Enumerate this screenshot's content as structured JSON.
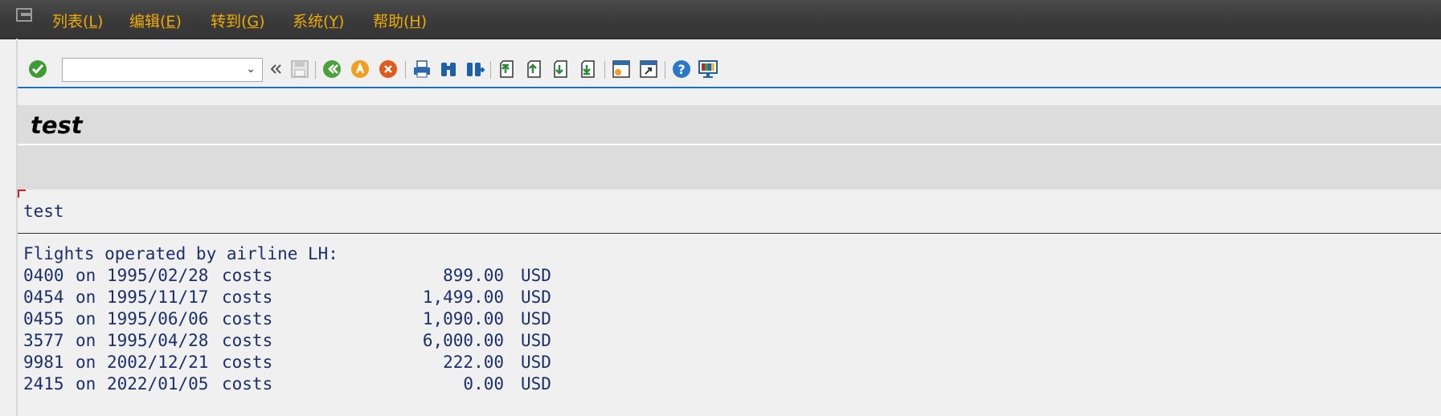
{
  "menubar": {
    "items": [
      {
        "label": "列表(",
        "key": "L",
        "end": ")"
      },
      {
        "label": "编辑(",
        "key": "E",
        "end": ")"
      },
      {
        "label": "转到(",
        "key": "G",
        "end": ")"
      },
      {
        "label": "系统(",
        "key": "Y",
        "end": ")"
      },
      {
        "label": "帮助(",
        "key": "H",
        "end": ")"
      }
    ]
  },
  "toolbar": {
    "command_value": "",
    "icons": [
      "enter-check-icon",
      "back-double-icon",
      "save-icon",
      "back-icon",
      "exit-icon",
      "cancel-icon",
      "print-icon",
      "find-icon",
      "find-next-icon",
      "first-page-icon",
      "previous-page-icon",
      "next-page-icon",
      "last-page-icon",
      "new-session-icon",
      "shortcut-icon",
      "help-icon",
      "customize-layout-icon"
    ]
  },
  "title": "test",
  "list": {
    "header": "test",
    "intro": "Flights operated by airline LH:",
    "rows": [
      {
        "connid": "0400",
        "on": "on",
        "date": "1995/02/28",
        "label": "costs",
        "price": "899.00",
        "currency": "USD"
      },
      {
        "connid": "0454",
        "on": "on",
        "date": "1995/11/17",
        "label": "costs",
        "price": "1,499.00",
        "currency": "USD"
      },
      {
        "connid": "0455",
        "on": "on",
        "date": "1995/06/06",
        "label": "costs",
        "price": "1,090.00",
        "currency": "USD"
      },
      {
        "connid": "3577",
        "on": "on",
        "date": "1995/04/28",
        "label": "costs",
        "price": "6,000.00",
        "currency": "USD"
      },
      {
        "connid": "9981",
        "on": "on",
        "date": "2002/12/21",
        "label": "costs",
        "price": "222.00",
        "currency": "USD"
      },
      {
        "connid": "2415",
        "on": "on",
        "date": "2022/01/05",
        "label": "costs",
        "price": "0.00",
        "currency": "USD"
      }
    ]
  },
  "colors": {
    "menu_text": "#f0ab00",
    "list_text": "#1b2f6b",
    "toolbar_rule": "#1a73c2"
  }
}
